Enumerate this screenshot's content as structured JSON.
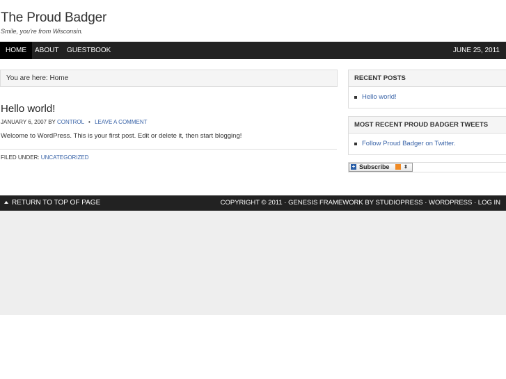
{
  "header": {
    "title": "The Proud Badger",
    "description": "Smile, you're from Wisconsin."
  },
  "nav": {
    "items": [
      {
        "label": "HOME"
      },
      {
        "label": "ABOUT"
      },
      {
        "label": "GUESTBOOK"
      }
    ],
    "date": "JUNE 25, 2011"
  },
  "breadcrumb": {
    "text": "You are here: Home"
  },
  "post": {
    "title": "Hello world!",
    "date": "JANUARY 6, 2007",
    "by": "BY",
    "author": "CONTROL",
    "bullet": "•",
    "comment_link": "LEAVE A COMMENT",
    "body": "Welcome to WordPress. This is your first post. Edit or delete it, then start blogging!",
    "filed_label": "FILED UNDER:",
    "category": "UNCATEGORIZED"
  },
  "sidebar": {
    "recent_posts": {
      "title": "RECENT POSTS",
      "items": [
        {
          "label": "Hello world!"
        }
      ]
    },
    "tweets": {
      "title": "MOST RECENT PROUD BADGER TWEETS",
      "items": [
        {
          "label": "Follow Proud Badger on Twitter."
        }
      ]
    },
    "subscribe": {
      "label": "Subscribe",
      "plus": "+",
      "arrows": "⇕"
    }
  },
  "footer": {
    "back_to_top": "RETURN TO TOP OF PAGE",
    "copyright": "COPYRIGHT © 2011 · GENESIS FRAMEWORK BY STUDIOPRESS · WORDPRESS · LOG IN"
  },
  "colors": {
    "nav_bg": "#222222",
    "nav_active": "#000000",
    "link": "#3a64a8",
    "gray_area": "#eeeeee"
  }
}
